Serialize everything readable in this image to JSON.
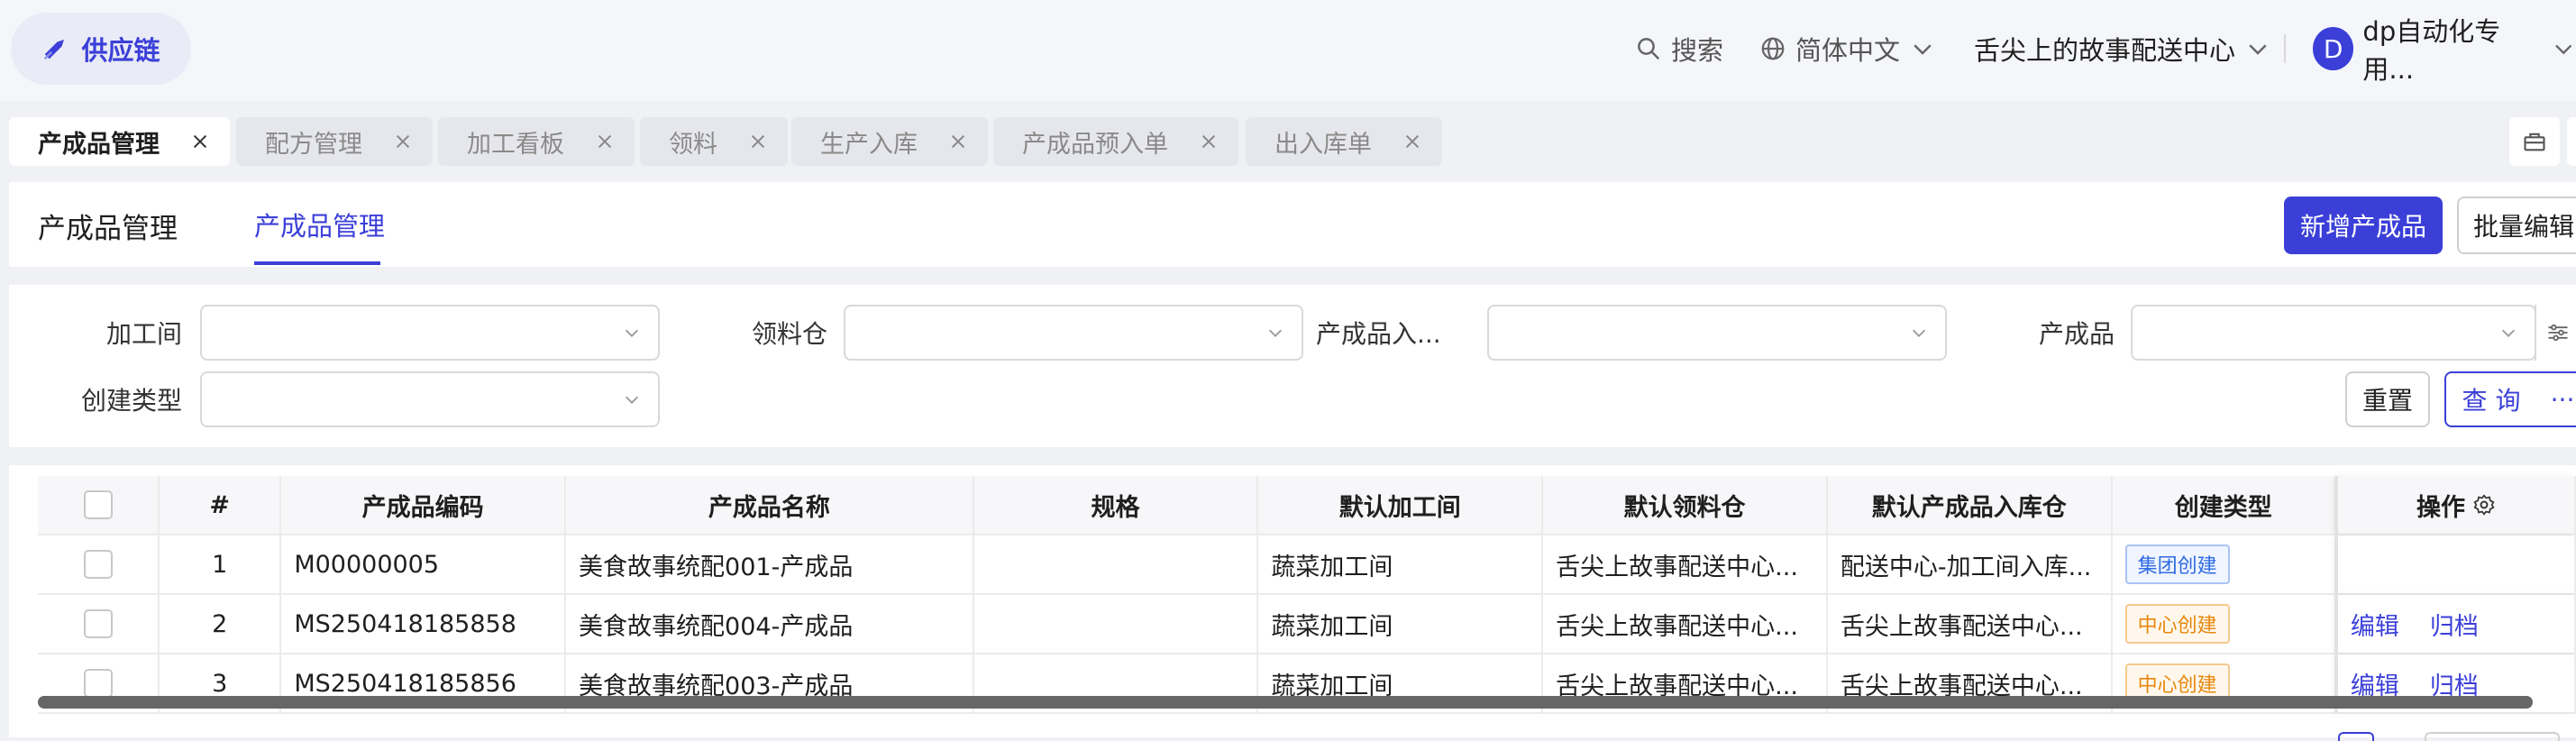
{
  "header": {
    "brand": "供应链",
    "search_label": "搜索",
    "language": "简体中文",
    "organization": "舌尖上的故事配送中心",
    "user_initial": "D",
    "user_name": "dp自动化专用..."
  },
  "tabs": [
    {
      "label": "产成品管理",
      "active": true
    },
    {
      "label": "配方管理",
      "active": false
    },
    {
      "label": "加工看板",
      "active": false
    },
    {
      "label": "领料",
      "active": false
    },
    {
      "label": "生产入库",
      "active": false
    },
    {
      "label": "产成品预入单",
      "active": false
    },
    {
      "label": "出入库单",
      "active": false
    }
  ],
  "page": {
    "title": "产成品管理",
    "sub_tab": "产成品管理",
    "new_button": "新增产成品",
    "batch_button": "批量编辑"
  },
  "filters": {
    "fields": [
      "加工间",
      "领料仓",
      "产成品入...",
      "产成品",
      "创建类型"
    ],
    "reset": "重置",
    "query": "查 询",
    "more": "···"
  },
  "table": {
    "columns": [
      "#",
      "产成品编码",
      "产成品名称",
      "规格",
      "默认加工间",
      "默认领料仓",
      "默认产成品入库仓",
      "创建类型",
      "操作"
    ],
    "rows": [
      {
        "index": "1",
        "code": "M00000005",
        "name": "美食故事统配001-产成品",
        "spec": "",
        "workshop": "蔬菜加工间",
        "material_wh": "舌尖上故事配送中心...",
        "product_wh": "配送中心-加工间入库...",
        "create_type": "集团创建",
        "type_color": "blue",
        "ops": []
      },
      {
        "index": "2",
        "code": "MS250418185858",
        "name": "美食故事统配004-产成品",
        "spec": "",
        "workshop": "蔬菜加工间",
        "material_wh": "舌尖上故事配送中心...",
        "product_wh": "舌尖上故事配送中心...",
        "create_type": "中心创建",
        "type_color": "orange",
        "ops": [
          "编辑",
          "归档"
        ]
      },
      {
        "index": "3",
        "code": "MS250418185856",
        "name": "美食故事统配003-产成品",
        "spec": "",
        "workshop": "蔬菜加工间",
        "material_wh": "舌尖上故事配送中心...",
        "product_wh": "舌尖上故事配送中心...",
        "create_type": "中心创建",
        "type_color": "orange",
        "ops": [
          "编辑",
          "归档"
        ]
      }
    ]
  },
  "colors": {
    "accent": "#3b3fd8",
    "blue_badge": "#2f6be5",
    "orange_badge": "#e8870b"
  },
  "icons": {
    "brand": "brand-icon",
    "search": "search-icon",
    "globe": "globe-icon",
    "chevron": "chevron-down-icon",
    "close": "close-icon",
    "gear": "gear-icon",
    "toolbox": "toolbox-icon",
    "filter": "filter-settings-icon"
  }
}
